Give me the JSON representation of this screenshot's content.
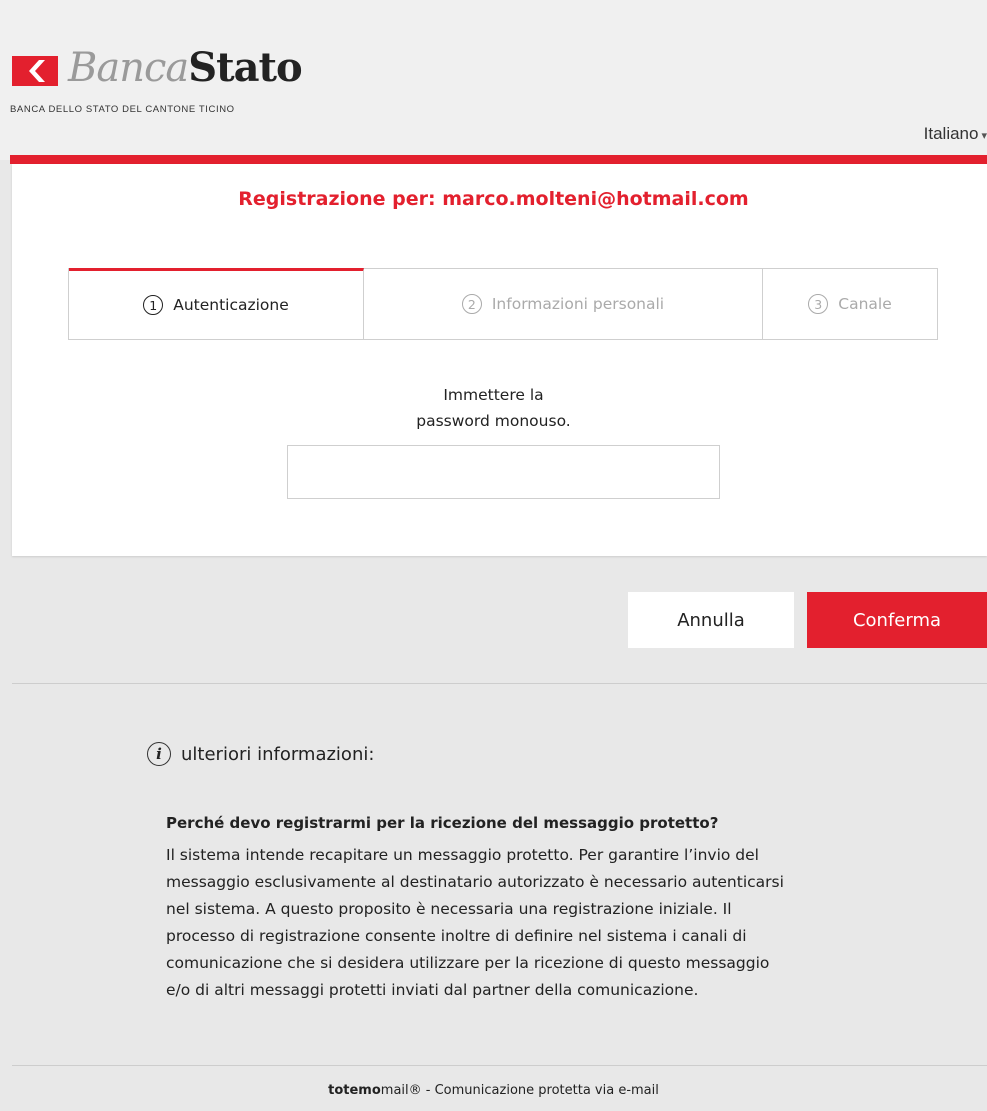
{
  "header": {
    "logo": {
      "word_banca": "Banca",
      "word_stato": "Stato",
      "subtitle": "BANCA DELLO STATO DEL CANTONE TICINO",
      "brand_color": "#e3202e"
    },
    "language": {
      "label": "Italiano",
      "icon": "chevron-down-icon"
    }
  },
  "registration": {
    "title": "Registrazione per: marco.molteni@hotmail.com",
    "steps": [
      {
        "number": "1",
        "label": "Autenticazione",
        "active": true
      },
      {
        "number": "2",
        "label": "Informazioni personali",
        "active": false
      },
      {
        "number": "3",
        "label": "Canale",
        "active": false
      }
    ],
    "password_prompt_line1": "Immettere la",
    "password_prompt_line2": "password monouso.",
    "password_value": ""
  },
  "actions": {
    "cancel_label": "Annulla",
    "confirm_label": "Conferma"
  },
  "info": {
    "icon": "info-icon",
    "heading": "ulteriori informazioni:",
    "question": "Perché devo registrarmi per la ricezione del messaggio protetto?",
    "answer_lines": [
      "Il sistema intende recapitare un messaggio protetto. Per garantire l’invio del",
      "messaggio esclusivamente al destinatario autorizzato è necessario autenticarsi",
      "nel sistema. A questo proposito è necessaria una registrazione iniziale. Il",
      "processo di registrazione consente inoltre di definire nel sistema i canali di",
      "comunicazione che si desidera utilizzare per la ricezione di questo messaggio",
      "e/o di altri messaggi protetti inviati dal partner della comunicazione."
    ]
  },
  "footer": {
    "brand_bold": "totemo",
    "brand_rest": "mail®",
    "separator": " - ",
    "text": "Comunicazione protetta via e-mail"
  },
  "colors": {
    "accent": "#e3202e",
    "background": "#e8e8e8",
    "card": "#ffffff"
  }
}
